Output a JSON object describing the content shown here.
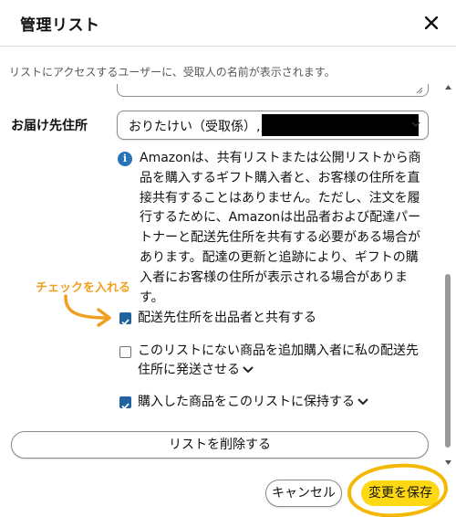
{
  "dialog": {
    "title": "管理リスト",
    "subtitle": "リストにアクセスするユーザーに、受取人の名前が表示されます。",
    "close_icon": "close-icon"
  },
  "address": {
    "label": "お届け先住所",
    "selected_value": "おりたけい（受取係）,"
  },
  "info": {
    "icon": "info-icon",
    "text": "Amazonは、共有リストまたは公開リストから商品を購入するギフト購入者と、お客様の住所を直接共有することはありません。ただし、注文を履行するために、Amazonは出品者および配達パートナーと配送先住所を共有する必要がある場合があります。配達の更新と追跡により、ギフトの購入者にお客様の住所が表示される場合があります。"
  },
  "annotation": {
    "text": "チェックを入れる"
  },
  "options": [
    {
      "label": "配送先住所を出品者と共有する",
      "checked": true
    },
    {
      "label": "このリストにない商品を追加購入者に私の配送先住所に発送させる",
      "checked": false
    },
    {
      "label": "購入した商品をこのリストに保持する",
      "checked": true
    }
  ],
  "buttons": {
    "delete_list": "リストを削除する",
    "cancel": "キャンセル",
    "save": "変更を保存"
  },
  "colors": {
    "accent_yellow": "#ffd814",
    "checkbox_blue": "#2162a1",
    "info_blue": "#2774b8",
    "annotation_orange": "#f0a020"
  }
}
